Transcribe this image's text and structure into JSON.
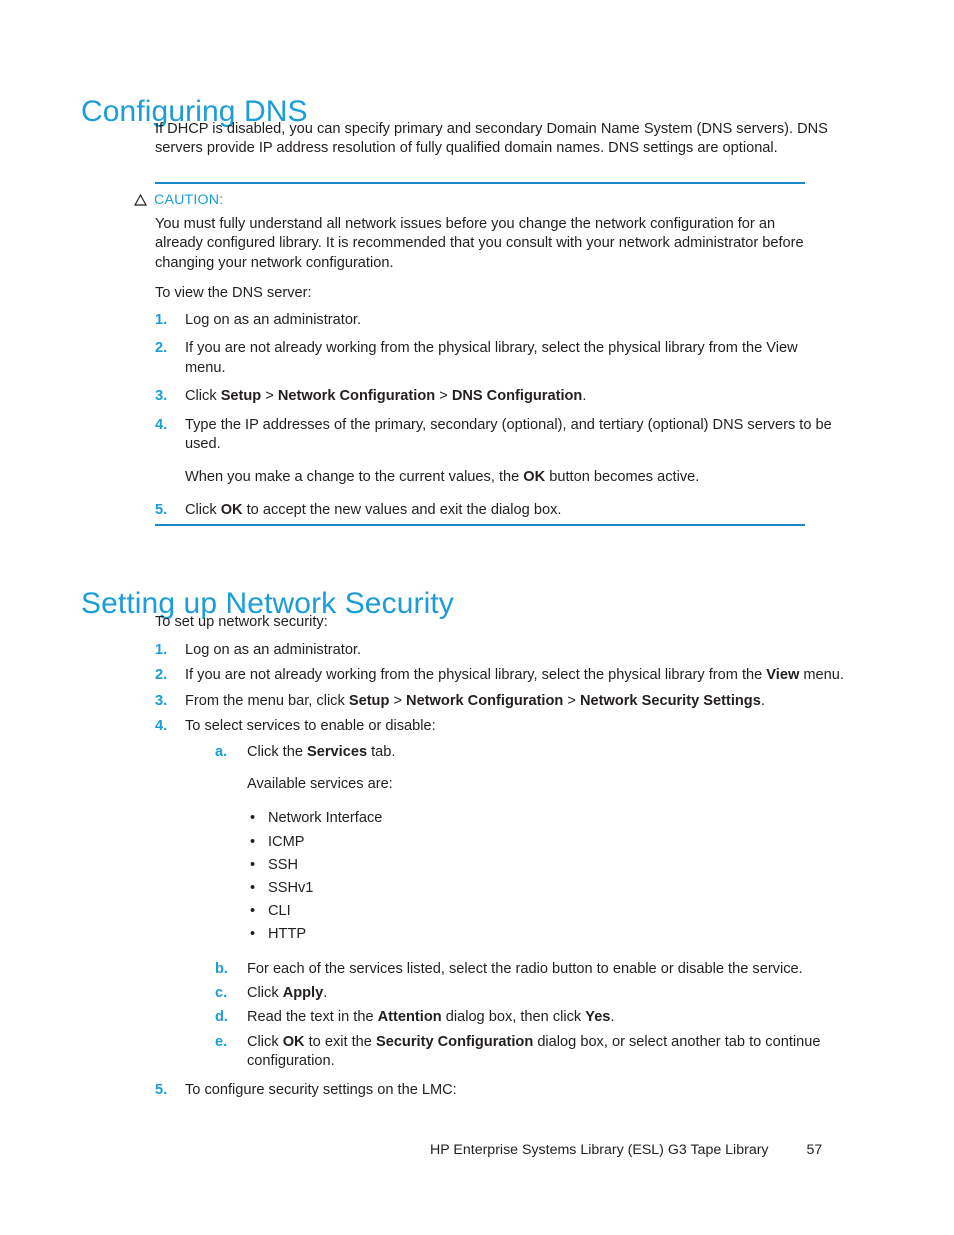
{
  "document": {
    "footer_title": "HP Enterprise Systems Library (ESL) G3 Tape Library",
    "page_number": "57"
  },
  "colors": {
    "heading_blue": "#1a9dd9",
    "rule_blue": "#1a87c8",
    "body_black": "#231f20"
  },
  "section_dns": {
    "heading": "Configuring DNS",
    "intro": "If DHCP is disabled, you can specify primary and secondary Domain Name System (DNS servers). DNS servers provide IP address resolution of fully qualified domain names. DNS settings are optional.",
    "caution": {
      "icon": "caution-triangle-icon",
      "label": "CAUTION:",
      "text": "You must fully understand all network issues before you change the network configuration for an already configured library. It is recommended that you consult with your network administrator before changing your network configuration."
    },
    "lead_in": "To view the DNS server:",
    "steps": [
      {
        "marker": "1.",
        "text": "Log on as an administrator."
      },
      {
        "marker": "2.",
        "text": "If you are not already working from the physical library, select the physical library from the View menu."
      },
      {
        "marker": "3.",
        "html": "Click <b>Setup</b> &gt; <b>Network Configuration</b> &gt; <b>DNS Configuration</b>."
      },
      {
        "marker": "4.",
        "text": "Type the IP addresses of the primary, secondary (optional), and tertiary (optional) DNS servers to be used.",
        "sub_paragraph_html": "When you make a change to the current values, the <b>OK</b> button becomes active."
      },
      {
        "marker": "5.",
        "html": "Click <b>OK</b> to accept the new values and exit the dialog box."
      }
    ]
  },
  "section_network_security": {
    "heading": "Setting up Network Security",
    "lead_in": "To set up network security:",
    "steps": [
      {
        "marker": "1.",
        "text": "Log on as an administrator."
      },
      {
        "marker": "2.",
        "html": "If you are not already working from the physical library, select the physical library from the <b>View</b> menu."
      },
      {
        "marker": "3.",
        "html": "From the menu bar, click <b>Setup</b> &gt; <b>Network Configuration</b> &gt; <b>Network Security Settings</b>."
      },
      {
        "marker": "4.",
        "text": "To select services to enable or disable:"
      },
      {
        "marker": "5.",
        "text": "To configure security settings on the LMC:"
      }
    ],
    "substeps": [
      {
        "marker": "a.",
        "html": "Click the <b>Services</b> tab.",
        "paragraph": "Available services are:"
      },
      {
        "marker": "b.",
        "text": "For each of the services listed, select the radio button to enable or disable the service."
      },
      {
        "marker": "c.",
        "html": "Click <b>Apply</b>."
      },
      {
        "marker": "d.",
        "html": "Read the text in the <b>Attention</b> dialog box, then click <b>Yes</b>."
      },
      {
        "marker": "e.",
        "html": "Click <b>OK</b> to exit the <b>Security Configuration</b> dialog box, or select another tab to continue configuration."
      }
    ],
    "services": [
      "Network Interface",
      "ICMP",
      "SSH",
      "SSHv1",
      "CLI",
      "HTTP"
    ],
    "bullet_glyph": "•"
  }
}
